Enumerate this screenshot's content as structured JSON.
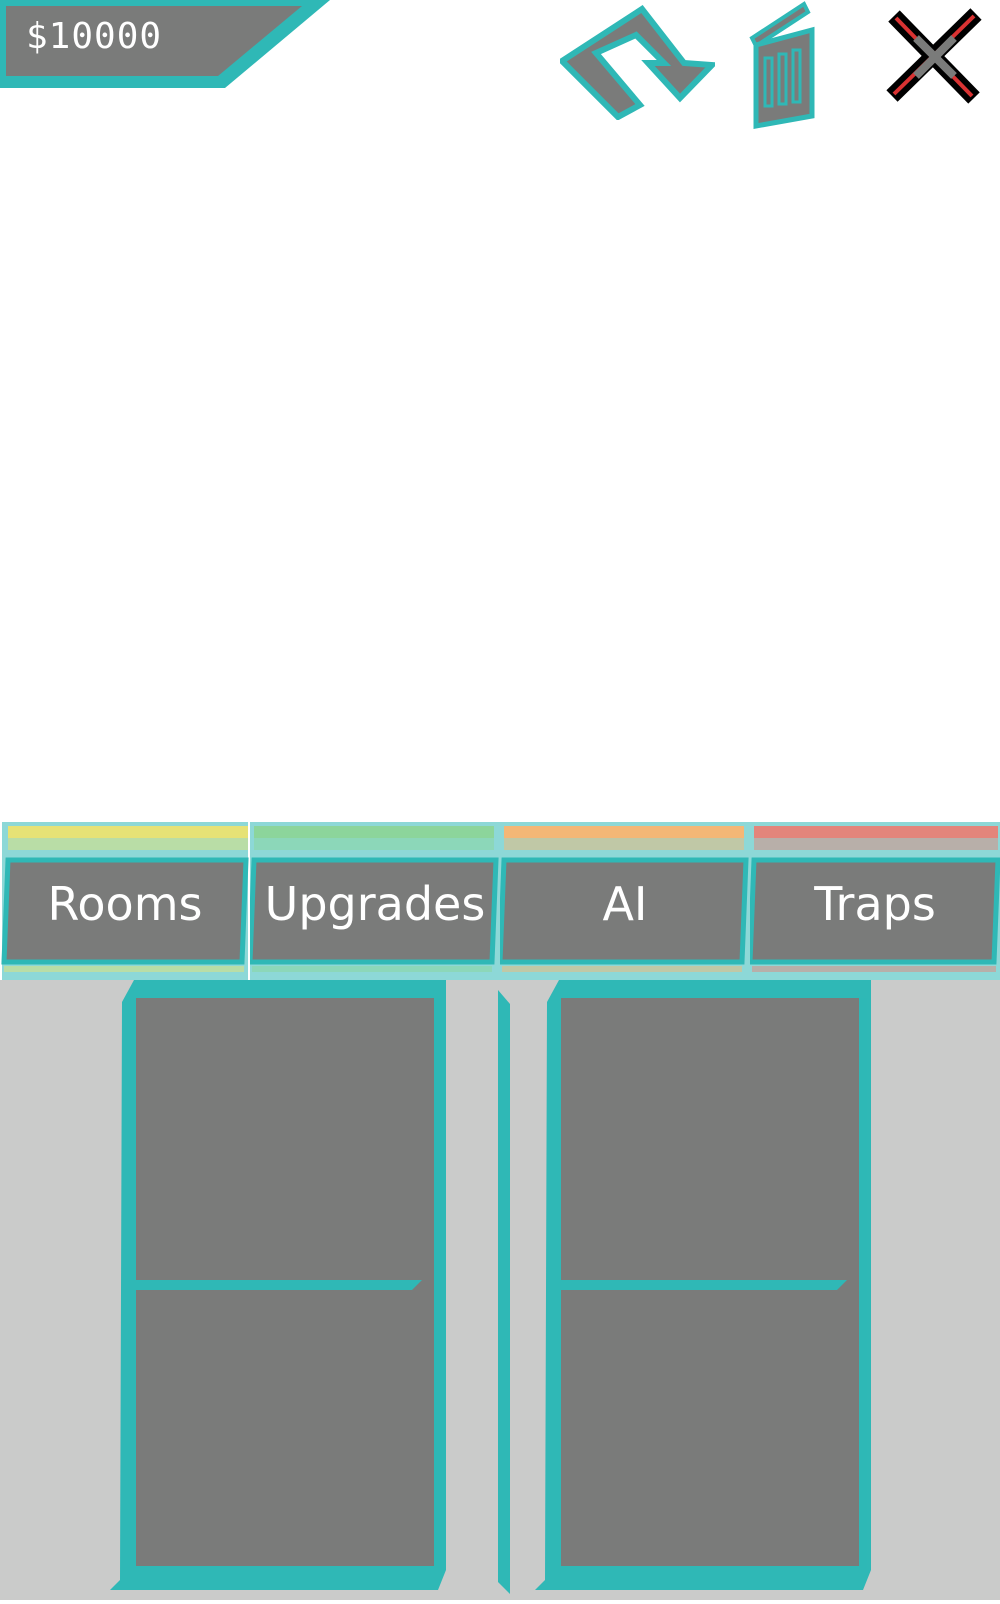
{
  "money": {
    "label": "$10000"
  },
  "toolbar": {
    "icons": [
      "rotate-icon",
      "trash-icon",
      "close-icon"
    ]
  },
  "tabs": [
    {
      "label": "Rooms",
      "accent": "#e6e276"
    },
    {
      "label": "Upgrades",
      "accent": "#8cd59b"
    },
    {
      "label": "AI",
      "accent": "#f4b776"
    },
    {
      "label": "Traps",
      "accent": "#e3857b"
    }
  ],
  "colors": {
    "teal": "#2fb8b6",
    "panel_gray": "#7a7b7a",
    "background_gray": "#cacbca",
    "close_red": "#d93232"
  }
}
